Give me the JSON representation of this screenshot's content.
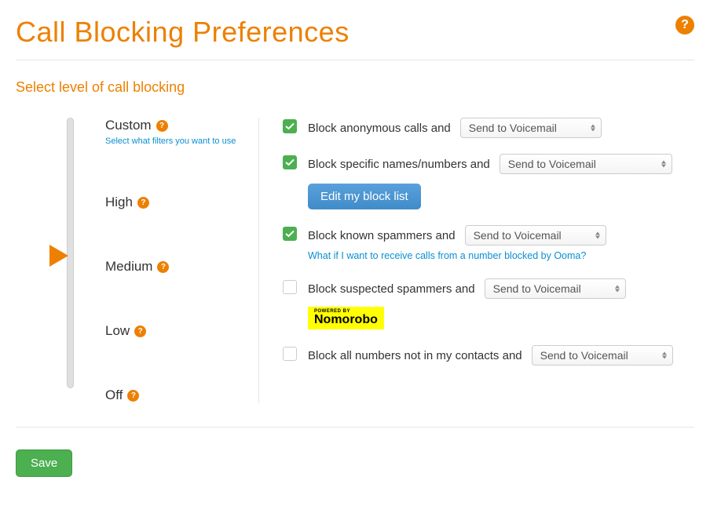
{
  "title": "Call Blocking Preferences",
  "subtitle": "Select level of call blocking",
  "levels": {
    "custom": {
      "label": "Custom",
      "desc": "Select what filters you want to use"
    },
    "high": {
      "label": "High"
    },
    "medium": {
      "label": "Medium"
    },
    "low": {
      "label": "Low"
    },
    "off": {
      "label": "Off"
    }
  },
  "selected_level": "Medium",
  "options": {
    "anon": {
      "label": "Block anonymous calls and",
      "select": "Send to Voicemail",
      "checked": true
    },
    "specific": {
      "label": "Block specific names/numbers and",
      "select": "Send to Voicemail",
      "checked": true,
      "edit_label": "Edit my block list"
    },
    "known": {
      "label": "Block known spammers and",
      "select": "Send to Voicemail",
      "checked": true,
      "link": "What if I want to receive calls from a number blocked by Ooma?"
    },
    "suspected": {
      "label": "Block suspected spammers and",
      "select": "Send to Voicemail",
      "checked": false,
      "brand": "Nomorobo",
      "brand_tag": "POWERED BY"
    },
    "contacts": {
      "label": "Block all numbers not in my contacts and",
      "select": "Send to Voicemail",
      "checked": false
    }
  },
  "save_label": "Save"
}
